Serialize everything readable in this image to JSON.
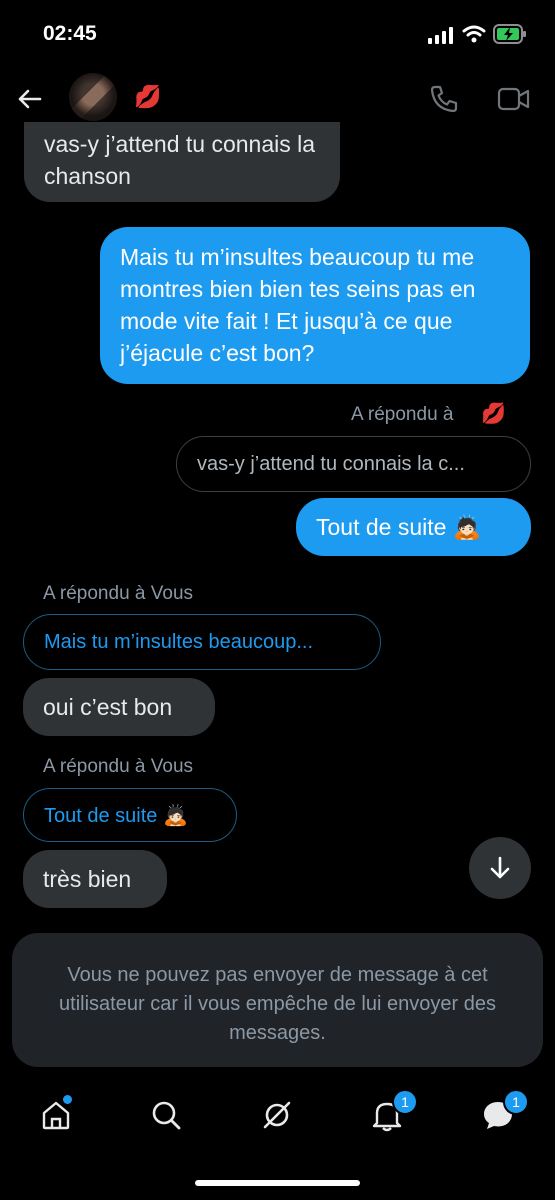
{
  "status_bar": {
    "time": "02:45"
  },
  "header": {
    "contact_emoji": "💋"
  },
  "messages": [
    {
      "from": "them",
      "text": "vas-y j’attend tu connais la chanson"
    },
    {
      "from": "me",
      "text": "Mais tu m’insultes beaucoup tu me montres bien bien tes seins pas en mode vite fait ! Et jusqu’à ce que j’éjacule c’est bon?"
    },
    {
      "from": "me",
      "reply_label": "A répondu à",
      "reply_emoji": "💋",
      "quoted": "vas-y j’attend tu connais la c...",
      "text": "Tout de suite 🙇🏻"
    },
    {
      "from": "them",
      "reply_label": "A répondu à Vous",
      "quoted": "Mais tu m’insultes beaucoup...",
      "text": "oui c’est bon"
    },
    {
      "from": "them",
      "reply_label": "A répondu à Vous",
      "quoted": "Tout de suite 🙇🏻",
      "text": "très bien"
    }
  ],
  "notice": "Vous ne pouvez pas envoyer de message à cet utilisateur car il vous empêche de lui envoyer des messages.",
  "tab_bar": {
    "notifications_badge": "1",
    "messages_badge": "1"
  },
  "colors": {
    "accent": "#1d9bf0",
    "incoming_bubble": "#2f3336",
    "notice_bg": "#202327"
  }
}
